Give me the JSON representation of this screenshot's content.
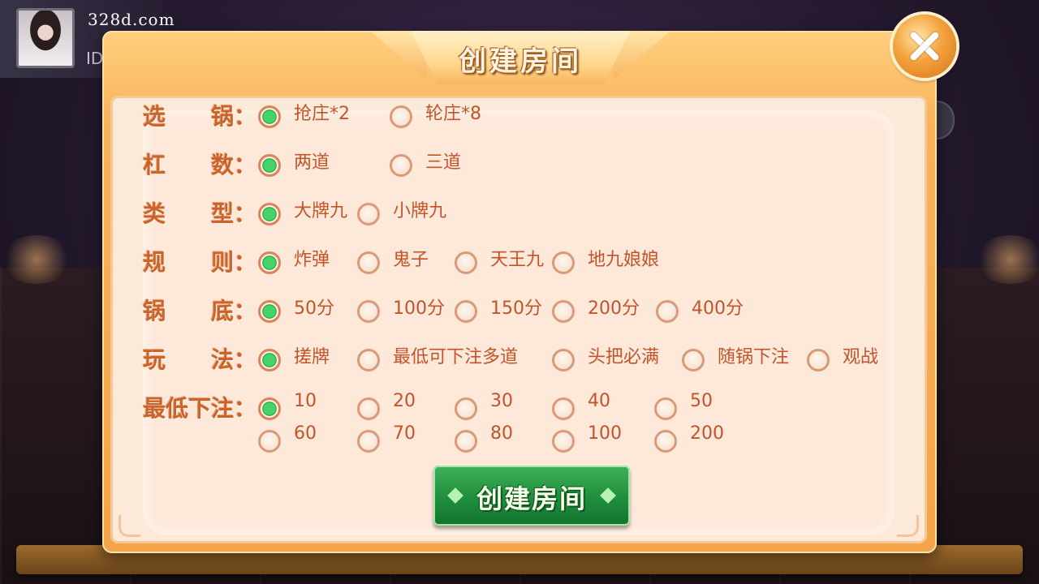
{
  "watermark": "328d.com",
  "profile": {
    "id_label": "ID"
  },
  "dialog": {
    "title": "创建房间",
    "create_button": "创建房间",
    "rows": [
      {
        "key": "pot",
        "label": "选　　锅：",
        "options": [
          {
            "label": "抢庄*2",
            "selected": true
          },
          {
            "label": "轮庄*8",
            "selected": false
          }
        ]
      },
      {
        "key": "bars",
        "label": "杠　　数：",
        "options": [
          {
            "label": "两道",
            "selected": true
          },
          {
            "label": "三道",
            "selected": false
          }
        ]
      },
      {
        "key": "type",
        "label": "类　　型：",
        "options": [
          {
            "label": "大牌九",
            "selected": true
          },
          {
            "label": "小牌九",
            "selected": false
          }
        ]
      },
      {
        "key": "rules",
        "label": "规　　则：",
        "options": [
          {
            "label": "炸弹",
            "selected": true
          },
          {
            "label": "鬼子",
            "selected": false
          },
          {
            "label": "天王九",
            "selected": false
          },
          {
            "label": "地九娘娘",
            "selected": false
          }
        ]
      },
      {
        "key": "base",
        "label": "锅　　底：",
        "options": [
          {
            "label": "50分",
            "selected": true
          },
          {
            "label": "100分",
            "selected": false
          },
          {
            "label": "150分",
            "selected": false
          },
          {
            "label": "200分",
            "selected": false
          },
          {
            "label": "400分",
            "selected": false
          }
        ]
      },
      {
        "key": "play",
        "label": "玩　　法：",
        "options": [
          {
            "label": "搓牌",
            "selected": true
          },
          {
            "label": "最低可下注多道",
            "selected": false
          },
          {
            "label": "头把必满",
            "selected": false
          },
          {
            "label": "随锅下注",
            "selected": false
          },
          {
            "label": "观战",
            "selected": false
          }
        ]
      },
      {
        "key": "min_bet",
        "label": "最低下注：",
        "options": [
          {
            "label": "10",
            "selected": true
          },
          {
            "label": "20",
            "selected": false
          },
          {
            "label": "30",
            "selected": false
          },
          {
            "label": "40",
            "selected": false
          },
          {
            "label": "50",
            "selected": false
          },
          {
            "label": "60",
            "selected": false
          },
          {
            "label": "70",
            "selected": false
          },
          {
            "label": "80",
            "selected": false
          },
          {
            "label": "100",
            "selected": false
          },
          {
            "label": "200",
            "selected": false
          }
        ]
      }
    ]
  }
}
